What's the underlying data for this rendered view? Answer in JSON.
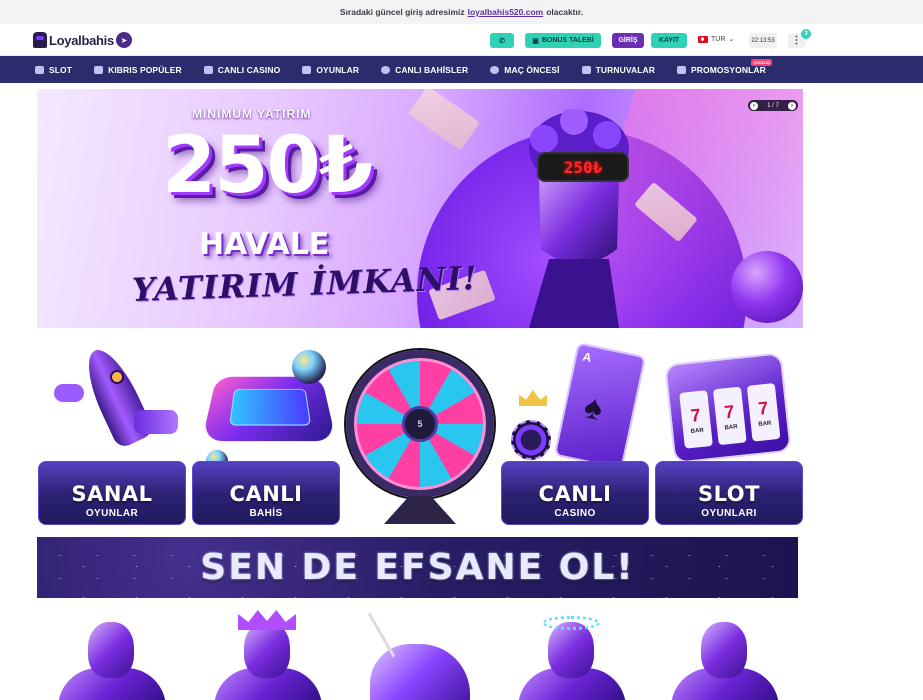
{
  "announcement": {
    "text": "Sıradaki güncel giriş adresimiz",
    "link": "loyalbahis520.com",
    "suffix": "olacaktır."
  },
  "header": {
    "logo_text": "Loyalbahis",
    "bonus_label": "BONUS TALEBİ",
    "login_label": "GİRİŞ",
    "register_label": "KAYIT",
    "language": "TUR",
    "time": "22:13:53",
    "notification_count": "3"
  },
  "nav": {
    "items": [
      {
        "label": "SLOT",
        "icon": "slot-icon"
      },
      {
        "label": "KIBRIS POPÜLER",
        "icon": "cards-icon"
      },
      {
        "label": "CANLI CASINO",
        "icon": "dealer-icon"
      },
      {
        "label": "OYUNLAR",
        "icon": "gamepad-icon"
      },
      {
        "label": "CANLI BAHİSLER",
        "icon": "live-icon"
      },
      {
        "label": "MAÇ ÖNCESİ",
        "icon": "football-icon"
      },
      {
        "label": "TURNUVALAR",
        "icon": "trophy-icon"
      },
      {
        "label": "PROMOSYONLAR",
        "icon": "gift-icon",
        "badge": "ÇEKİLİŞ"
      }
    ]
  },
  "hero": {
    "min_label": "MİNİMUM YATIRIM",
    "amount": "250₺",
    "method": "HAVALE",
    "tagline": "YATIRIM İMKANI!",
    "visor_text": "250₺",
    "slide_position": "1 / 7"
  },
  "categories": [
    {
      "title": "SANAL",
      "subtitle": "OYUNLAR"
    },
    {
      "title": "CANLI",
      "subtitle": "BAHİS"
    },
    {
      "title": "",
      "subtitle": ""
    },
    {
      "title": "CANLI",
      "subtitle": "CASINO"
    },
    {
      "title": "SLOT",
      "subtitle": "OYUNLARI"
    }
  ],
  "wheel_center": "5",
  "banner_text": "SEN DE EFSANE OL!",
  "colors": {
    "nav_bg": "#2b2c6e",
    "accent_teal": "#2fd1b7",
    "accent_purple": "#6b2fb3"
  }
}
